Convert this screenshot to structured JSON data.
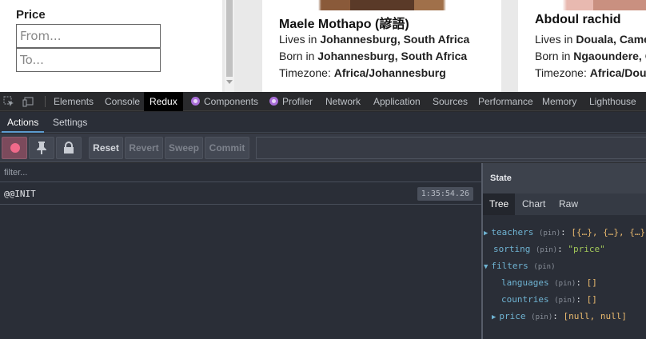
{
  "webpage": {
    "filters": {
      "price_label": "Price",
      "from_placeholder": "From...",
      "to_placeholder": "To..."
    },
    "cards": [
      {
        "name": "Maele Mothapo (諺語)",
        "lives_prefix": "Lives in ",
        "lives": "Johannesburg, South Africa",
        "born_prefix": "Born in ",
        "born": "Johannesburg, South Africa",
        "tz_prefix": "Timezone: ",
        "timezone": "Africa/Johannesburg"
      },
      {
        "name": "Abdoul rachid",
        "lives_prefix": "Lives in ",
        "lives": "Douala, Camer",
        "born_prefix": "Born in ",
        "born": "Ngaoundere, C",
        "tz_prefix": "Timezone: ",
        "timezone": "Africa/Doua"
      }
    ]
  },
  "devtools": {
    "tabs": [
      "Elements",
      "Console",
      "Redux",
      "Components",
      "Profiler",
      "Network",
      "Application",
      "Sources",
      "Performance",
      "Memory",
      "Lighthouse"
    ],
    "active_tab": "Redux",
    "redux": {
      "subtabs": [
        "Actions",
        "Settings"
      ],
      "active_subtab": "Actions",
      "toolbar": {
        "reset": "Reset",
        "revert": "Revert",
        "sweep": "Sweep",
        "commit": "Commit"
      },
      "filter_placeholder": "filter...",
      "actions": [
        {
          "name": "@@INIT",
          "time": "1:35:54.26"
        }
      ],
      "state": {
        "header": "State",
        "tabs": [
          "Tree",
          "Chart",
          "Raw"
        ],
        "active_tab": "Tree",
        "tree": {
          "teachers_key": "teachers",
          "teachers_value": "[{…}, {…}, {…},",
          "sorting_key": "sorting",
          "sorting_value": "\"price\"",
          "filters_key": "filters",
          "languages_key": "languages",
          "languages_value": "[]",
          "countries_key": "countries",
          "countries_value": "[]",
          "price_key": "price",
          "price_value": "[null, null]",
          "pin": "(pin)"
        }
      }
    }
  }
}
